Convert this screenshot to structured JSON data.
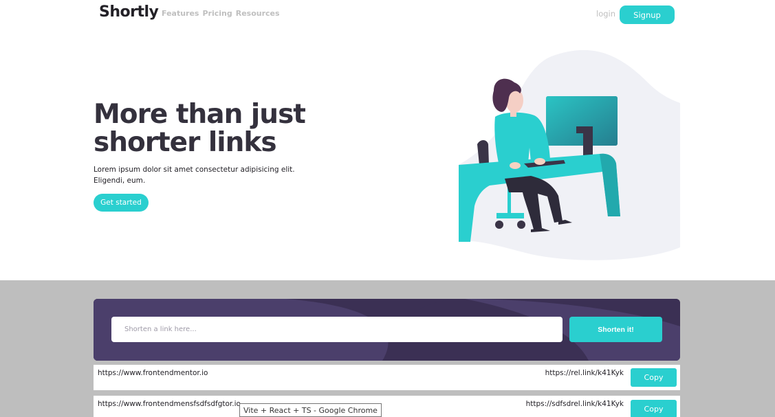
{
  "header": {
    "logo": "Shortly",
    "nav": [
      "Features",
      "Pricing",
      "Resources"
    ],
    "login": "login",
    "signup": "Signup"
  },
  "hero": {
    "title": "More than just shorter links",
    "text": "Lorem ipsum dolor sit amet consectetur adipisicing elit. Eligendi, eum.",
    "cta": "Get started",
    "illustration_icon": "person-working-illustration"
  },
  "shorten": {
    "placeholder": "Shorten a link here...",
    "button": "Shorten it!"
  },
  "results": [
    {
      "original": "https://www.frontendmentor.io",
      "short": "https://rel.link/k41Kyk",
      "copy": "Copy"
    },
    {
      "original": "https://www.frontendmensfsdfsdfgtor.io",
      "short": "https://sdfsdrel.link/k41Kyk",
      "copy": "Copy"
    }
  ],
  "tooltip": "Vite + React + TS - Google Chrome",
  "colors": {
    "accent": "#2acfcf",
    "dark_violet": "#3b3054",
    "heading": "#34313d",
    "gray_bg": "#bebebe"
  }
}
